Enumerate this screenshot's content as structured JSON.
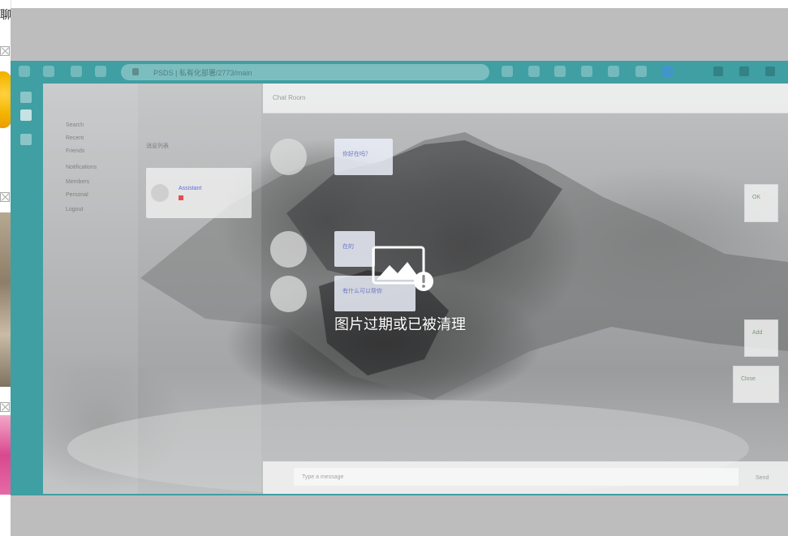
{
  "left_strip": {
    "partial_char": "聊"
  },
  "window": {
    "url": "PSDS | 私有化部署/2773/main",
    "sidebar_items": [
      "Search",
      "Recent",
      "Friends",
      "Notifications",
      "Members",
      "Personal",
      "Logout"
    ],
    "list_title": "消息列表",
    "list_card": {
      "name": "Assistant"
    },
    "chat_title": "Chat Room",
    "messages": [
      {
        "text": "你好在吗？"
      },
      {
        "text": "在的"
      },
      {
        "text": "有什么可以帮你"
      }
    ],
    "right_buttons": [
      "OK",
      "Add",
      "Close"
    ],
    "input": {
      "placeholder": "Type a message",
      "send_label": "Send"
    }
  },
  "overlay": {
    "text": "图片过期或已被清理"
  }
}
